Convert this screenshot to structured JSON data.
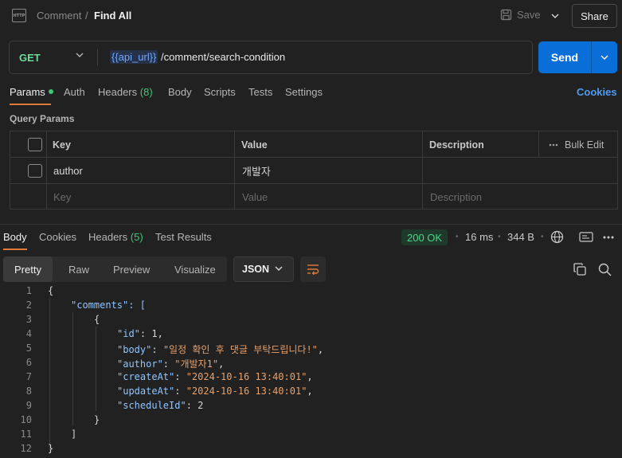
{
  "header": {
    "http_badge": "HTTP",
    "breadcrumb_parent": "Comment",
    "breadcrumb_sep": "/",
    "title": "Find All",
    "save_label": "Save",
    "share_label": "Share"
  },
  "request": {
    "method": "GET",
    "url_variable": "{{api_url}}",
    "url_path": "/comment/search-condition",
    "send_label": "Send"
  },
  "request_tabs": {
    "params": "Params",
    "auth": "Auth",
    "headers": "Headers",
    "headers_count": "(8)",
    "body": "Body",
    "scripts": "Scripts",
    "tests": "Tests",
    "settings": "Settings",
    "cookies": "Cookies"
  },
  "query_params": {
    "title": "Query Params",
    "columns": {
      "key": "Key",
      "value": "Value",
      "description": "Description",
      "bulk_edit": "Bulk Edit"
    },
    "rows": [
      {
        "key": "author",
        "value": "개발자",
        "description": ""
      }
    ],
    "placeholder": {
      "key": "Key",
      "value": "Value",
      "description": "Description"
    }
  },
  "response_tabs": {
    "body": "Body",
    "cookies": "Cookies",
    "headers": "Headers",
    "headers_count": "(5)",
    "test_results": "Test Results"
  },
  "response_meta": {
    "status": "200 OK",
    "time": "16 ms",
    "size": "344 B",
    "status_color": "#4ed38a"
  },
  "view": {
    "options": [
      "Pretty",
      "Raw",
      "Preview",
      "Visualize"
    ],
    "active": "Pretty",
    "format": "JSON"
  },
  "code_lines": [
    {
      "n": "1",
      "text": "{"
    },
    {
      "n": "2",
      "text": "\"comments\": ["
    },
    {
      "n": "3",
      "text": "{"
    },
    {
      "n": "4",
      "key": "\"id\"",
      "val": "1,"
    },
    {
      "n": "5",
      "key": "\"body\"",
      "str": "\"일정 확인 후 댓글 부탁드립니다!\"",
      "tail": ","
    },
    {
      "n": "6",
      "key": "\"author\"",
      "str": "\"개발자1\"",
      "tail": ","
    },
    {
      "n": "7",
      "key": "\"createAt\"",
      "str": "\"2024-10-16 13:40:01\"",
      "tail": ","
    },
    {
      "n": "8",
      "key": "\"updateAt\"",
      "str": "\"2024-10-16 13:40:01\"",
      "tail": ","
    },
    {
      "n": "9",
      "key": "\"scheduleId\"",
      "val": "2"
    },
    {
      "n": "10",
      "text": "}"
    },
    {
      "n": "11",
      "text": "]"
    },
    {
      "n": "12",
      "text": "}"
    }
  ]
}
